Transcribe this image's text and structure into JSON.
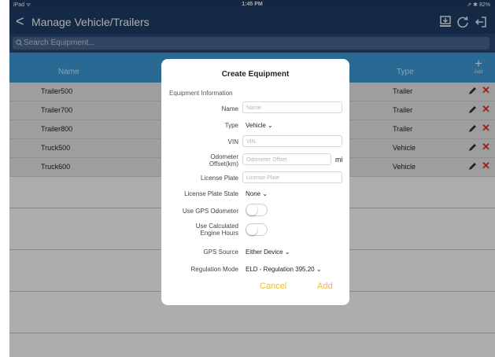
{
  "status_bar": {
    "left": "iPad ᯤ",
    "time": "1:45 PM",
    "right": "⇗ ✱ 82%"
  },
  "nav": {
    "title": "Manage Vehicle/Trailers",
    "back_glyph": "<"
  },
  "search": {
    "placeholder": "Search Equipment..."
  },
  "table": {
    "headers": {
      "name": "Name",
      "type": "Type",
      "add_label": "Add",
      "add_glyph": "+"
    },
    "rows": [
      {
        "name": "Trailer500",
        "type": "Trailer"
      },
      {
        "name": "Trailer700",
        "type": "Trailer"
      },
      {
        "name": "Trailer800",
        "type": "Trailer"
      },
      {
        "name": "Truck500",
        "type": "Vehicle"
      },
      {
        "name": "Truck600",
        "type": "Vehicle"
      }
    ],
    "delete_glyph": "✕"
  },
  "modal": {
    "title": "Create Equipment",
    "section": "Equipment Information",
    "name": {
      "label": "Name",
      "placeholder": "Name"
    },
    "type": {
      "label": "Type",
      "value": "Vehicle"
    },
    "vin": {
      "label": "VIN",
      "placeholder": "VIN"
    },
    "odometer": {
      "label_line1": "Odometer",
      "label_line2": "Offset(km)",
      "placeholder": "Odometer Offset",
      "unit": "mi"
    },
    "plate": {
      "label": "License Plate",
      "placeholder": "License Plate"
    },
    "plate_state": {
      "label": "License Plate State",
      "value": "None"
    },
    "gps_odometer": {
      "label": "Use GPS Odometer",
      "on": false
    },
    "engine_hours": {
      "label_line1": "Use Calculated",
      "label_line2": "Engine Hours",
      "on": false
    },
    "gps_source": {
      "label": "GPS Source",
      "value": "Either Device"
    },
    "regulation": {
      "label": "Regulation Mode",
      "value": "ELD - Regulation 395.20"
    },
    "chevron": "⌄",
    "cancel_label": "Cancel",
    "add_label": "Add"
  },
  "colors": {
    "nav": "#1e3d66",
    "table_header": "#3d9bd9",
    "accent": "#f3bd13",
    "delete": "#d9352b"
  }
}
